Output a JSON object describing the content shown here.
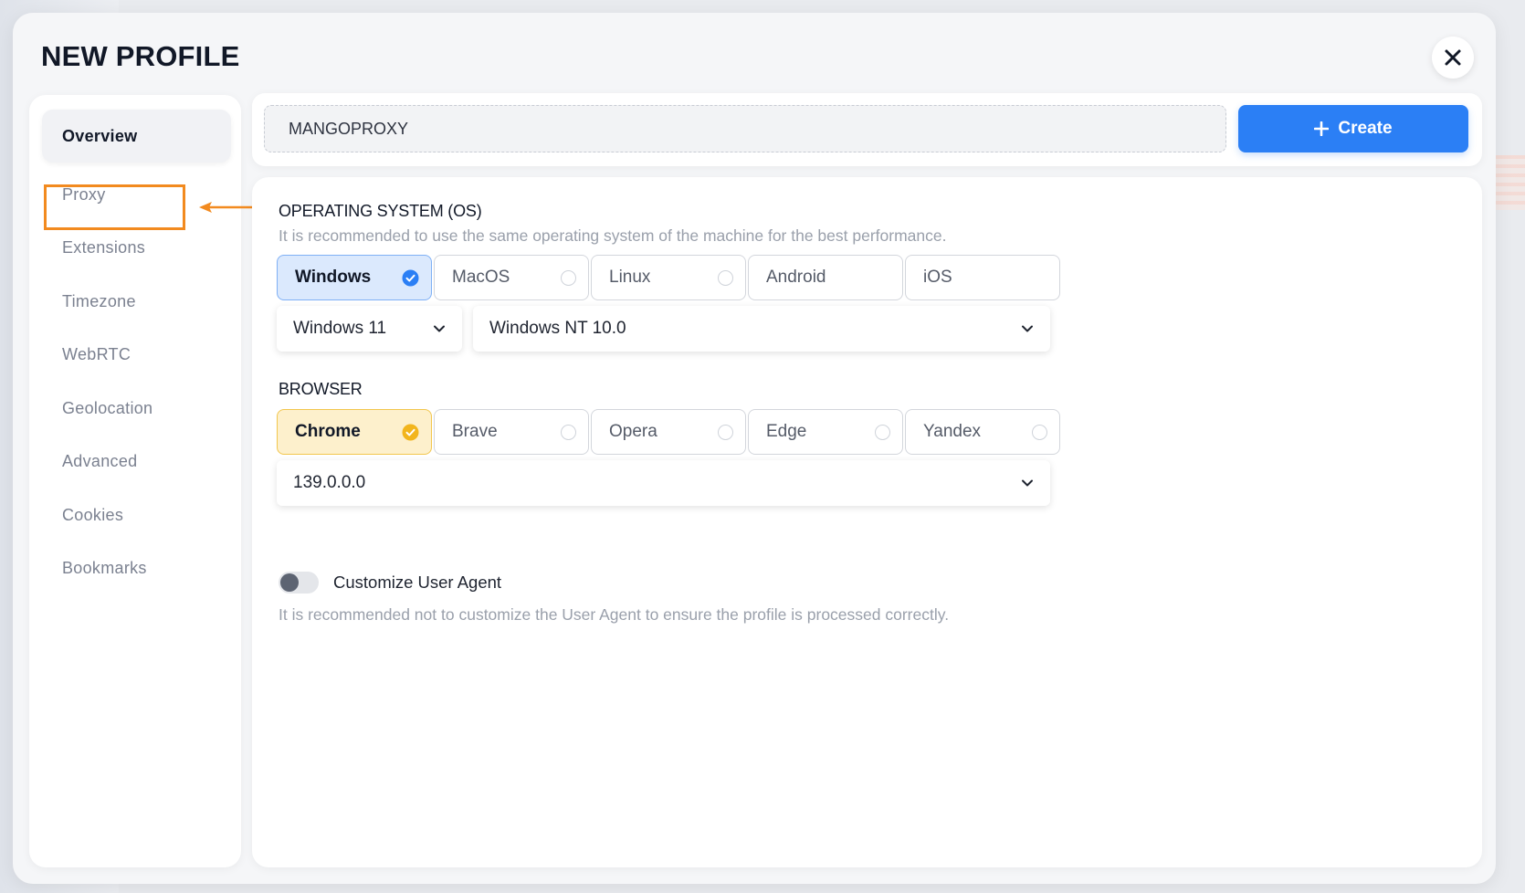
{
  "dialog": {
    "title": "NEW PROFILE"
  },
  "sidebar": {
    "items": [
      {
        "label": "Overview",
        "active": true
      },
      {
        "label": "Proxy"
      },
      {
        "label": "Extensions"
      },
      {
        "label": "Timezone"
      },
      {
        "label": "WebRTC"
      },
      {
        "label": "Geolocation"
      },
      {
        "label": "Advanced"
      },
      {
        "label": "Cookies"
      },
      {
        "label": "Bookmarks"
      }
    ],
    "highlighted_item": "Proxy",
    "annotation_color": "#f28a1f"
  },
  "topbar": {
    "profile_name_value": "MANGOPROXY",
    "create_label": "Create",
    "create_color": "#2b7ff5"
  },
  "os": {
    "title": "OPERATING SYSTEM (OS)",
    "hint": "It is recommended to use the same operating system of the machine for the best performance.",
    "options": [
      "Windows",
      "MacOS",
      "Linux",
      "Android",
      "iOS"
    ],
    "selected": "Windows",
    "version": "Windows 11",
    "platform": "Windows NT 10.0"
  },
  "browser": {
    "title": "BROWSER",
    "options": [
      "Chrome",
      "Brave",
      "Opera",
      "Edge",
      "Yandex"
    ],
    "selected": "Chrome",
    "version": "139.0.0.0"
  },
  "user_agent": {
    "toggle_label": "Customize User Agent",
    "enabled": false,
    "hint": "It is recommended not to customize the User Agent to ensure the profile is processed correctly."
  },
  "icons": {
    "close": "close-icon",
    "plus": "plus-icon",
    "check": "check-circle-icon",
    "chevron": "chevron-down-icon",
    "arrow": "arrow-left-icon"
  }
}
